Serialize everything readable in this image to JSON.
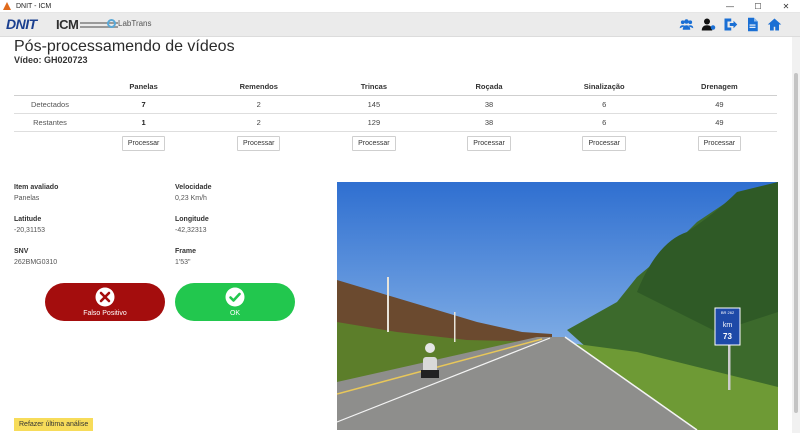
{
  "window": {
    "title": "DNIT - ICM",
    "minimize": "—",
    "maximize": "☐",
    "close": "✕"
  },
  "brand": {
    "dnit": "DNIT",
    "icm": "ICM",
    "labtrans": "LabTrans"
  },
  "header_icons": [
    "team-icon",
    "user-settings-icon",
    "sign-out-icon",
    "document-icon",
    "home-icon"
  ],
  "page": {
    "title": "Pós-processamendo de vídeos",
    "video": "Vídeo: GH020723"
  },
  "table": {
    "columns": [
      "Panelas",
      "Remendos",
      "Trincas",
      "Roçada",
      "Sinalização",
      "Drenagem"
    ],
    "rows": [
      {
        "label": "Detectados",
        "values": [
          "7",
          "2",
          "145",
          "38",
          "6",
          "49"
        ]
      },
      {
        "label": "Restantes",
        "values": [
          "1",
          "2",
          "129",
          "38",
          "6",
          "49"
        ]
      }
    ],
    "action_label": "Processar"
  },
  "details": {
    "item": {
      "label": "Item avaliado",
      "value": "Panelas"
    },
    "speed": {
      "label": "Velocidade",
      "value": "0,23 Km/h"
    },
    "lat": {
      "label": "Latitude",
      "value": "-20,31153"
    },
    "lon": {
      "label": "Longitude",
      "value": "-42,32313"
    },
    "snv": {
      "label": "SNV",
      "value": "262BMG0310"
    },
    "frame": {
      "label": "Frame",
      "value": "1'53\""
    }
  },
  "buttons": {
    "false_positive": "Falso Positivo",
    "ok": "OK",
    "redo": "Refazer última análise"
  },
  "photo_sign": {
    "top": "BR 262",
    "mid": "km",
    "num": "73"
  },
  "colors": {
    "brand_blue": "#1a3f8f",
    "icon_blue": "#1a6fd4",
    "danger": "#a40d0d",
    "success": "#22c74e",
    "warning": "#f7dc5a"
  }
}
